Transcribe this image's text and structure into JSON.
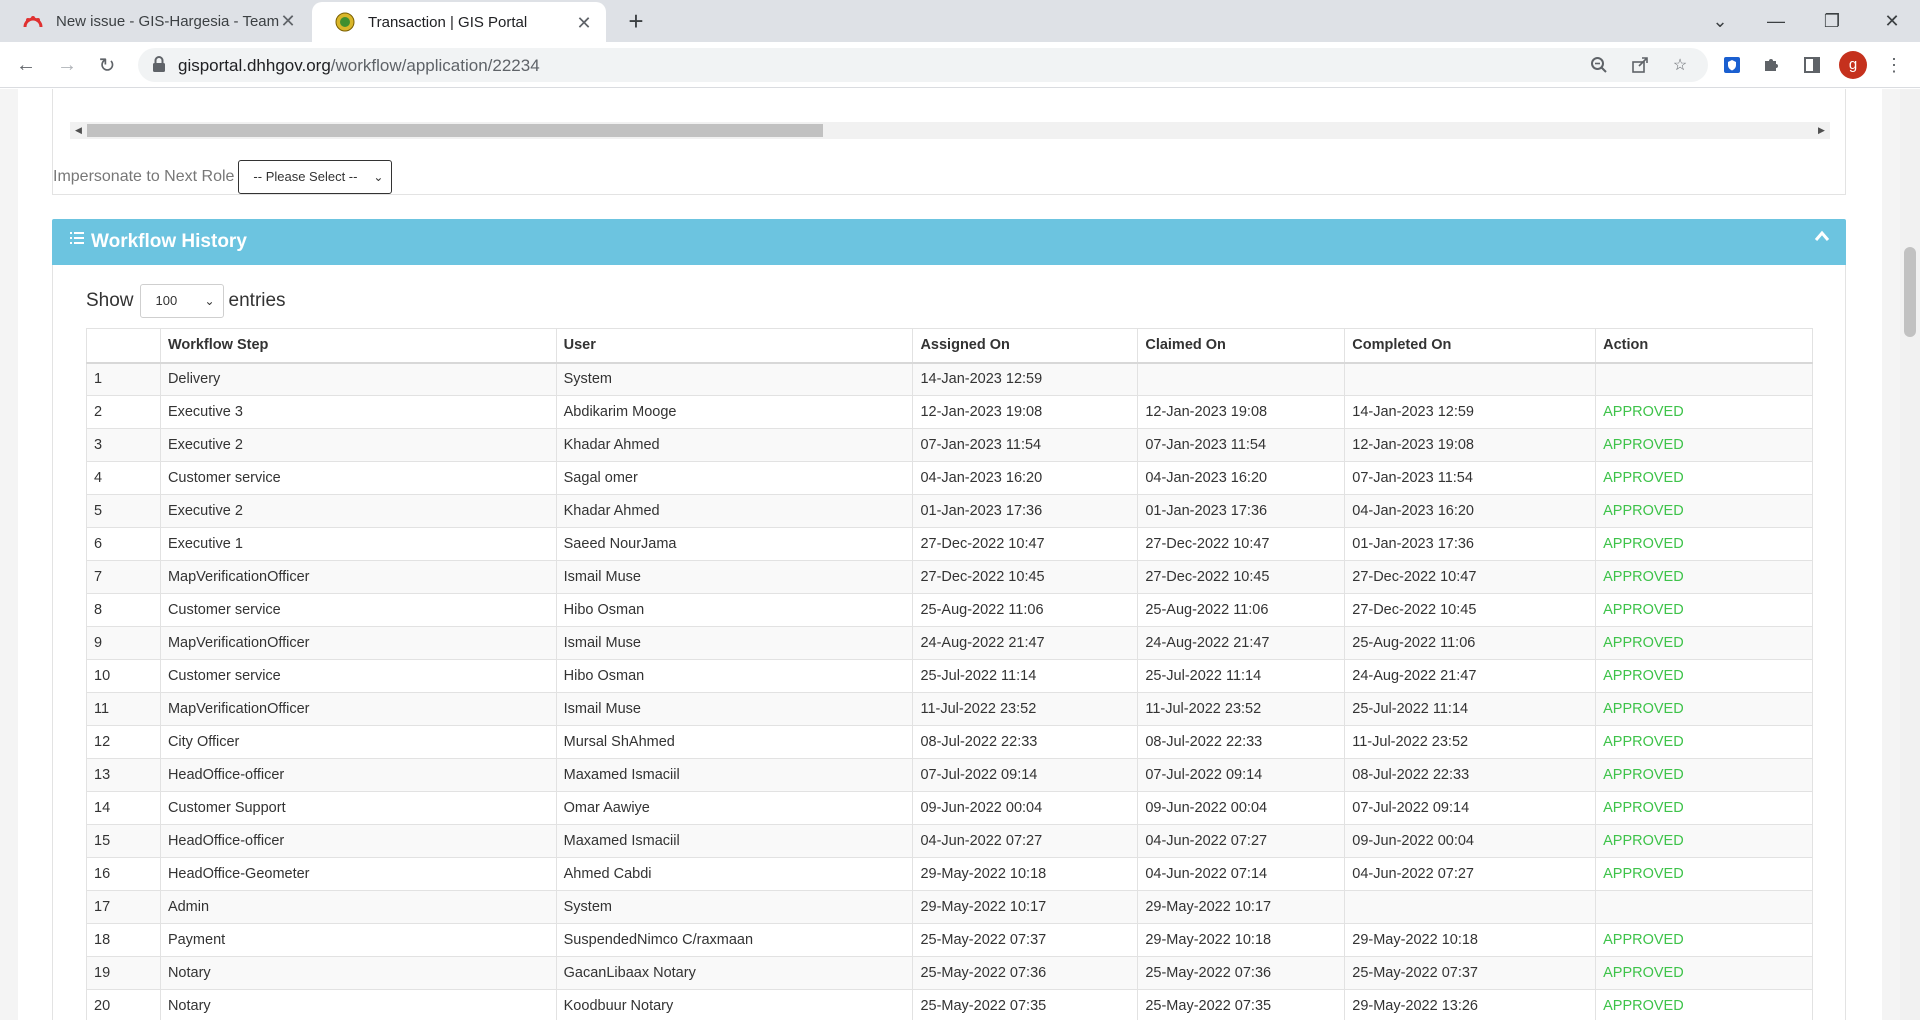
{
  "browser": {
    "tabs": [
      {
        "title": "New issue - GIS-Hargesia - Team",
        "favicon": "team-logo-icon",
        "active": false
      },
      {
        "title": "Transaction | GIS Portal",
        "favicon": "gis-portal-seal-icon",
        "active": true
      }
    ],
    "url_host": "gisportal.dhhgov.org",
    "url_path": "/workflow/application/22234",
    "profile_initial": "g"
  },
  "top_panel": {
    "impersonate_label": "Impersonate to Next Role",
    "impersonate_value": "-- Please Select --"
  },
  "workflow": {
    "title": "Workflow History",
    "show_label": "Show",
    "entries_value": "100",
    "entries_label": "entries",
    "columns": [
      "",
      "Workflow Step",
      "User",
      "Assigned On",
      "Claimed On",
      "Completed On",
      "Action"
    ],
    "rows": [
      [
        "1",
        "Delivery",
        "System",
        "14-Jan-2023 12:59",
        "",
        "",
        ""
      ],
      [
        "2",
        "Executive 3",
        "Abdikarim Mooge",
        "12-Jan-2023 19:08",
        "12-Jan-2023 19:08",
        "14-Jan-2023 12:59",
        "APPROVED"
      ],
      [
        "3",
        "Executive 2",
        "Khadar Ahmed",
        "07-Jan-2023 11:54",
        "07-Jan-2023 11:54",
        "12-Jan-2023 19:08",
        "APPROVED"
      ],
      [
        "4",
        "Customer service",
        "Sagal omer",
        "04-Jan-2023 16:20",
        "04-Jan-2023 16:20",
        "07-Jan-2023 11:54",
        "APPROVED"
      ],
      [
        "5",
        "Executive 2",
        "Khadar Ahmed",
        "01-Jan-2023 17:36",
        "01-Jan-2023 17:36",
        "04-Jan-2023 16:20",
        "APPROVED"
      ],
      [
        "6",
        "Executive 1",
        "Saeed NourJama",
        "27-Dec-2022 10:47",
        "27-Dec-2022 10:47",
        "01-Jan-2023 17:36",
        "APPROVED"
      ],
      [
        "7",
        "MapVerificationOfficer",
        "Ismail Muse",
        "27-Dec-2022 10:45",
        "27-Dec-2022 10:45",
        "27-Dec-2022 10:47",
        "APPROVED"
      ],
      [
        "8",
        "Customer service",
        "Hibo Osman",
        "25-Aug-2022 11:06",
        "25-Aug-2022 11:06",
        "27-Dec-2022 10:45",
        "APPROVED"
      ],
      [
        "9",
        "MapVerificationOfficer",
        "Ismail Muse",
        "24-Aug-2022 21:47",
        "24-Aug-2022 21:47",
        "25-Aug-2022 11:06",
        "APPROVED"
      ],
      [
        "10",
        "Customer service",
        "Hibo Osman",
        "25-Jul-2022 11:14",
        "25-Jul-2022 11:14",
        "24-Aug-2022 21:47",
        "APPROVED"
      ],
      [
        "11",
        "MapVerificationOfficer",
        "Ismail Muse",
        "11-Jul-2022 23:52",
        "11-Jul-2022 23:52",
        "25-Jul-2022 11:14",
        "APPROVED"
      ],
      [
        "12",
        "City Officer",
        "Mursal ShAhmed",
        "08-Jul-2022 22:33",
        "08-Jul-2022 22:33",
        "11-Jul-2022 23:52",
        "APPROVED"
      ],
      [
        "13",
        "HeadOffice-officer",
        "Maxamed Ismaciil",
        "07-Jul-2022 09:14",
        "07-Jul-2022 09:14",
        "08-Jul-2022 22:33",
        "APPROVED"
      ],
      [
        "14",
        "Customer Support",
        "Omar Aawiye",
        "09-Jun-2022 00:04",
        "09-Jun-2022 00:04",
        "07-Jul-2022 09:14",
        "APPROVED"
      ],
      [
        "15",
        "HeadOffice-officer",
        "Maxamed Ismaciil",
        "04-Jun-2022 07:27",
        "04-Jun-2022 07:27",
        "09-Jun-2022 00:04",
        "APPROVED"
      ],
      [
        "16",
        "HeadOffice-Geometer",
        "Ahmed Cabdi",
        "29-May-2022 10:18",
        "04-Jun-2022 07:14",
        "04-Jun-2022 07:27",
        "APPROVED"
      ],
      [
        "17",
        "Admin",
        "System",
        "29-May-2022 10:17",
        "29-May-2022 10:17",
        "",
        ""
      ],
      [
        "18",
        "Payment",
        "SuspendedNimco C/raxmaan",
        "25-May-2022 07:37",
        "29-May-2022 10:18",
        "29-May-2022 10:18",
        "APPROVED"
      ],
      [
        "19",
        "Notary",
        "GacanLibaax Notary",
        "25-May-2022 07:36",
        "25-May-2022 07:36",
        "25-May-2022 07:37",
        "APPROVED"
      ],
      [
        "20",
        "Notary",
        "Koodbuur Notary",
        "25-May-2022 07:35",
        "25-May-2022 07:35",
        "29-May-2022 13:26",
        "APPROVED"
      ]
    ]
  },
  "colors": {
    "header_bg": "#6cc4e0",
    "approved": "#3ec34a",
    "profile": "#c5311d"
  }
}
